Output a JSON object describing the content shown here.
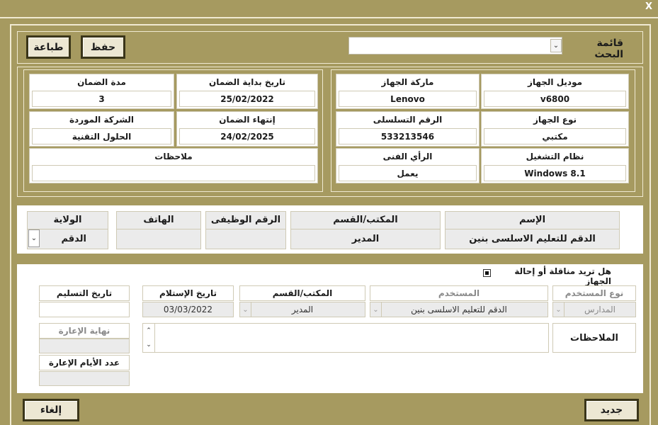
{
  "window": {
    "close_label": "X"
  },
  "toolbar": {
    "print_label": "طباعة",
    "save_label": "حفظ",
    "search_label": "قائمة البحث",
    "search_value": ""
  },
  "device": {
    "model": {
      "label": "موديل الجهاز",
      "value": "v6800"
    },
    "brand": {
      "label": "ماركة الجهاز",
      "value": "Lenovo"
    },
    "type": {
      "label": "نوع الجهاز",
      "value": "مكتبي"
    },
    "serial": {
      "label": "الرقم التسلسلى",
      "value": "533213546"
    },
    "os": {
      "label": "نظام التشغيل",
      "value": "Windows 8.1"
    },
    "tech_opinion": {
      "label": "الرأي الفنى",
      "value": "يعمل"
    },
    "warranty_start": {
      "label": "تاريخ بداية الضمان",
      "value": "25/02/2022"
    },
    "warranty_period": {
      "label": "مدة الضمان",
      "value": "3"
    },
    "warranty_end": {
      "label": "إنتهاء الضمان",
      "value": "24/02/2025"
    },
    "supplier": {
      "label": "الشركة الموردة",
      "value": "الحلول التقنية"
    },
    "notes": {
      "label": "ملاحظات",
      "value": ""
    }
  },
  "owner": {
    "name": {
      "label": "الإسم",
      "value": "الدقم للتعليم الاسلسى بنين"
    },
    "office": {
      "label": "المكتب/القسم",
      "value": "المدير"
    },
    "job_number": {
      "label": "الرقم الوظيفى",
      "value": ""
    },
    "phone": {
      "label": "الهاتف",
      "value": ""
    },
    "state": {
      "label": "الولاية",
      "value": "الدقم"
    }
  },
  "transfer": {
    "question": "هل تريد مناقلة أو إحالة الجهاز",
    "user_type": {
      "label": "نوع المستخدم",
      "value": "المدارس"
    },
    "user": {
      "label": "المستخدم",
      "value": "الدقم للتعليم الاسلسى بنين"
    },
    "office": {
      "label": "المكتب/القسم",
      "value": "المدير"
    },
    "receive_date": {
      "label": "تاريخ الإستلام",
      "value": "03/03/2022"
    },
    "delivery_date": {
      "label": "تاريخ التسليم",
      "value": ""
    },
    "notes_label": "الملاحظات",
    "notes_value": "",
    "loan_end": {
      "label": "نهاية الإعارة",
      "value": ""
    },
    "loan_days": {
      "label": "عدد الأيام الإعارة",
      "value": ""
    }
  },
  "footer": {
    "new_label": "جديد",
    "cancel_label": "إلغاء"
  }
}
